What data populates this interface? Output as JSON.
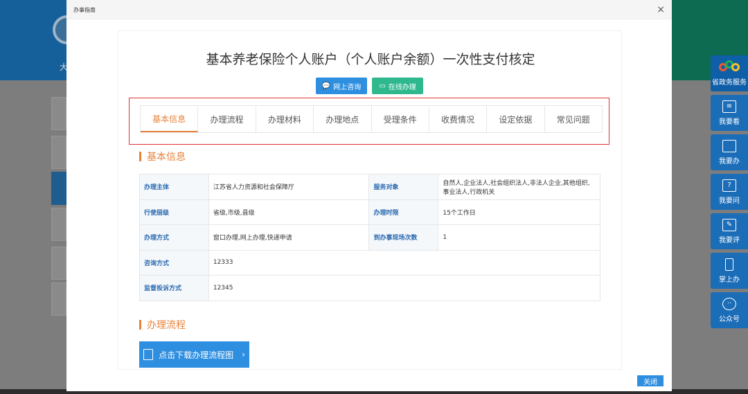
{
  "modal": {
    "title": "办事指南",
    "close_glyph": "×",
    "close_button": "关闭"
  },
  "page": {
    "title": "基本养老保险个人账户（个人账户余额）一次性支付核定",
    "btn_consult": "网上咨询",
    "btn_online": "在线办理"
  },
  "tabs": [
    {
      "label": "基本信息",
      "active": true
    },
    {
      "label": "办理流程",
      "active": false
    },
    {
      "label": "办理材料",
      "active": false
    },
    {
      "label": "办理地点",
      "active": false
    },
    {
      "label": "受理条件",
      "active": false
    },
    {
      "label": "收费情况",
      "active": false
    },
    {
      "label": "设定依据",
      "active": false
    },
    {
      "label": "常见问题",
      "active": false
    }
  ],
  "sections": {
    "basic_info": "基本信息",
    "process": "办理流程"
  },
  "info_table": [
    {
      "k1": "办理主体",
      "v1": "江苏省人力资源和社会保障厅",
      "k2": "服务对象",
      "v2": "自然人,企业法人,社会组织法人,非法人企业,其他组织,事业法人,行政机关"
    },
    {
      "k1": "行使层级",
      "v1": "省级,市级,县级",
      "k2": "办理时限",
      "v2": "15个工作日"
    },
    {
      "k1": "办理方式",
      "v1": "窗口办理,网上办理,快递申请",
      "k2": "到办事现场次数",
      "v2": "1"
    },
    {
      "k1": "咨询方式",
      "v1": "12333"
    },
    {
      "k1": "监督投诉方式",
      "v1": "12345"
    }
  ],
  "download_button": "点击下载办理流程图",
  "download_arrow": "›",
  "sidebar": [
    {
      "label": "省政务服务",
      "icon": "app-logo-icon"
    },
    {
      "label": "我要看",
      "icon": "document-icon"
    },
    {
      "label": "我要办",
      "icon": "monitor-icon"
    },
    {
      "label": "我要问",
      "icon": "question-icon"
    },
    {
      "label": "我要评",
      "icon": "edit-icon"
    },
    {
      "label": "掌上办",
      "icon": "mobile-icon"
    },
    {
      "label": "公众号",
      "icon": "wechat-icon"
    }
  ],
  "background": {
    "header_fragment": "大"
  }
}
